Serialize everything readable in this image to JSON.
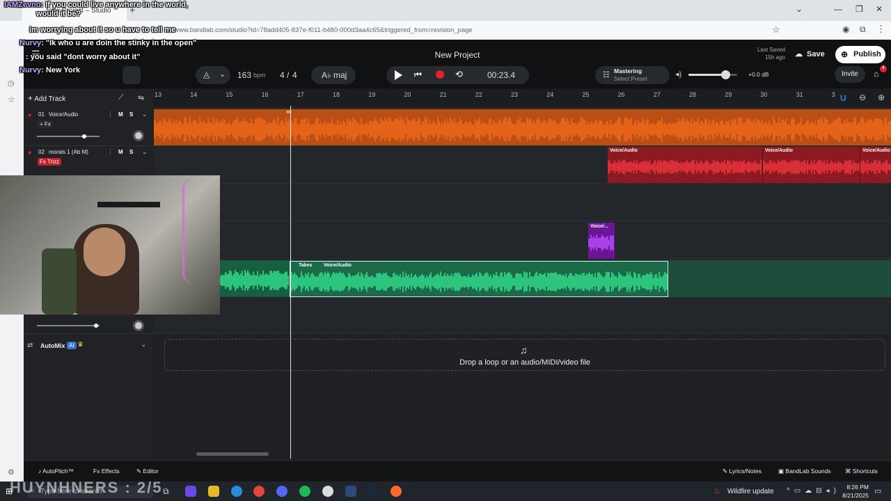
{
  "browser": {
    "tab_title": "New Project – Studio",
    "url": "www.bandlab.com/studio?id=78add405-837e-f011-b480-000d3aa4c65&triggered_from=revision_page"
  },
  "studio": {
    "title": "New Project",
    "last_saved_label": "Last Saved",
    "last_saved_value": "15h ago",
    "save_label": "Save",
    "publish_label": "Publish",
    "invite_label": "Invite",
    "notification_count": "4",
    "tempo_value": "163",
    "tempo_unit": "bpm",
    "time_sig_num": "4",
    "time_sig_den": "4",
    "key": "A♭ maj",
    "time": "00:23.4",
    "mastering_label": "Mastering",
    "mastering_preset": "Select Preset",
    "volume_db": "+0.0 dB",
    "volume_level": 0.75
  },
  "add_track_label": "Add Track",
  "tracks": [
    {
      "num": "01",
      "name": "Voice/Audio",
      "fx": "+ Fx",
      "mute": "M",
      "solo": "S"
    },
    {
      "num": "02",
      "name": "morals 1 (Ab M)",
      "fx": "Fx Trizz",
      "mute": "M",
      "solo": "S"
    }
  ],
  "ruler": [
    "13",
    "14",
    "15",
    "16",
    "17",
    "18",
    "19",
    "20",
    "21",
    "22",
    "23",
    "24",
    "25",
    "26",
    "27",
    "28",
    "29",
    "30",
    "31",
    "3"
  ],
  "clips": {
    "red_label_1": "Voice/Audio",
    "red_label_2": "Voice/Audio",
    "red_label_3": "Voice/Audio",
    "purple_label": "Voice/...",
    "green_takes": "Takes",
    "green_label": "Voice/Audio"
  },
  "automix_label": "AutoMix",
  "automix_badge": "AI",
  "drop_text": "Drop a loop or an audio/MIDI/video file",
  "bottom": {
    "autopitch": "AutoPitch™",
    "effects": "Effects",
    "editor": "Editor",
    "lyrics": "Lyrics/Notes",
    "sounds": "BandLab Sounds",
    "shortcuts": "Shortcuts"
  },
  "taskbar": {
    "search": "Type here to search",
    "weather": "Wildfire update",
    "time": "8:26 PM",
    "date": "8/21/2025"
  },
  "chat": [
    {
      "name": "IAMZevno",
      "text": ": If you could live anywhere in the world,"
    },
    {
      "name": "",
      "text": "would it be?"
    },
    {
      "name": "",
      "text": "im worrying about it so u have to tell me"
    },
    {
      "name": "Nurvy",
      "text": ": \"Ik who u are doin the stinky in the open\""
    },
    {
      "name": "",
      "text": ": you said \"dont worry about it\""
    },
    {
      "name": "Nurvy",
      "text": ": New York"
    }
  ],
  "watermark": "HUYNHNERS : 2/5",
  "colors": {
    "orange": "#e8661a",
    "red": "#c5202a",
    "purple": "#8a22c8",
    "green": "#2fcf84"
  }
}
